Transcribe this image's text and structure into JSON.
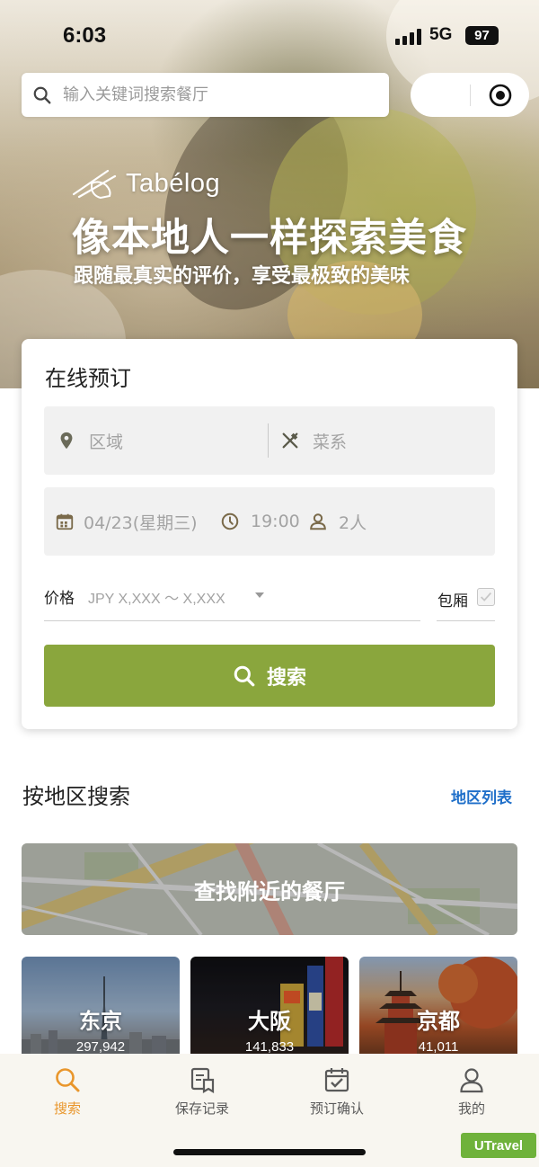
{
  "status_bar": {
    "time": "6:03",
    "network": "5G",
    "battery": "97"
  },
  "search": {
    "placeholder": "输入关键词搜索餐厅"
  },
  "hero": {
    "brand": "Tabélog",
    "title": "像本地人一样探索美食",
    "subtitle": "跟随最真实的评价，享受最极致的美味"
  },
  "booking": {
    "title": "在线预订",
    "area_placeholder": "区域",
    "cuisine_placeholder": "菜系",
    "date": "04/23(星期三)",
    "time": "19:00",
    "people": "2人",
    "price_label": "价格",
    "price_value": "JPY X,XXX ～ X,XXX",
    "private_room_label": "包厢",
    "search_button": "搜索"
  },
  "area": {
    "title": "按地区搜索",
    "list_link": "地区列表",
    "nearby_banner": "查找附近的餐厅",
    "cities": [
      {
        "name": "东京",
        "count": "297,942"
      },
      {
        "name": "大阪",
        "count": "141,833"
      },
      {
        "name": "京都",
        "count": "41,011"
      }
    ]
  },
  "tabbar": {
    "items": [
      {
        "label": "搜索",
        "icon": "search-icon"
      },
      {
        "label": "保存记录",
        "icon": "saved-list-icon"
      },
      {
        "label": "预订确认",
        "icon": "calendar-check-icon"
      },
      {
        "label": "我的",
        "icon": "user-icon"
      }
    ]
  },
  "colors": {
    "accent_green": "#8aa63d",
    "link_blue": "#1f6fc9",
    "tab_active": "#e9962b"
  },
  "watermark": "UTravel"
}
